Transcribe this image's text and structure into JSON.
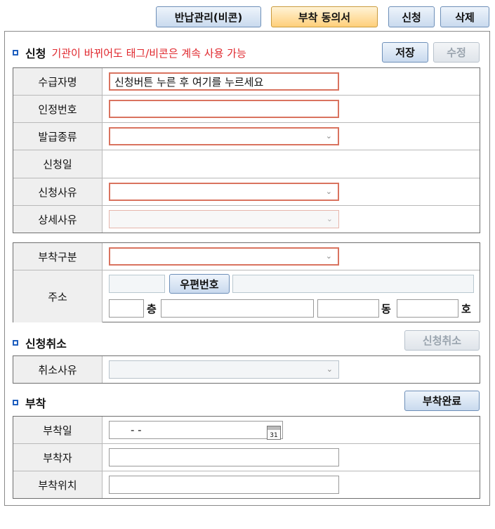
{
  "top_buttons": {
    "return_mgmt": "반납관리(비콘)",
    "consent": "부착 동의서",
    "apply": "신청",
    "delete": "삭제"
  },
  "apply_section": {
    "title": "신청",
    "note": "기관이 바뀌어도 태그/비콘은 계속 사용 가능",
    "save": "저장",
    "edit": "수정",
    "fields": {
      "recipient_label": "수급자명",
      "recipient_value": "신청버튼 누른 후 여기를 누르세요",
      "cert_label": "인정번호",
      "issue_type_label": "발급종류",
      "apply_date_label": "신청일",
      "reason_label": "신청사유",
      "detail_reason_label": "상세사유"
    },
    "attach_type_label": "부착구분",
    "address_label": "주소",
    "postal_button": "우편번호",
    "floor_suffix": "층",
    "dong_suffix": "동",
    "ho_suffix": "호"
  },
  "cancel_section": {
    "title": "신청취소",
    "cancel_button": "신청취소",
    "cancel_reason_label": "취소사유"
  },
  "attach_section": {
    "title": "부착",
    "complete_button": "부착완료",
    "date_label": "부착일",
    "date_value": "-   -",
    "calendar_day": "31",
    "person_label": "부착자",
    "location_label": "부착위치"
  },
  "colors": {
    "accent_blue": "#1f5fbf",
    "required_border": "#d9735f",
    "note_red": "#e0282e",
    "consent_button": "#ffcf7a"
  }
}
